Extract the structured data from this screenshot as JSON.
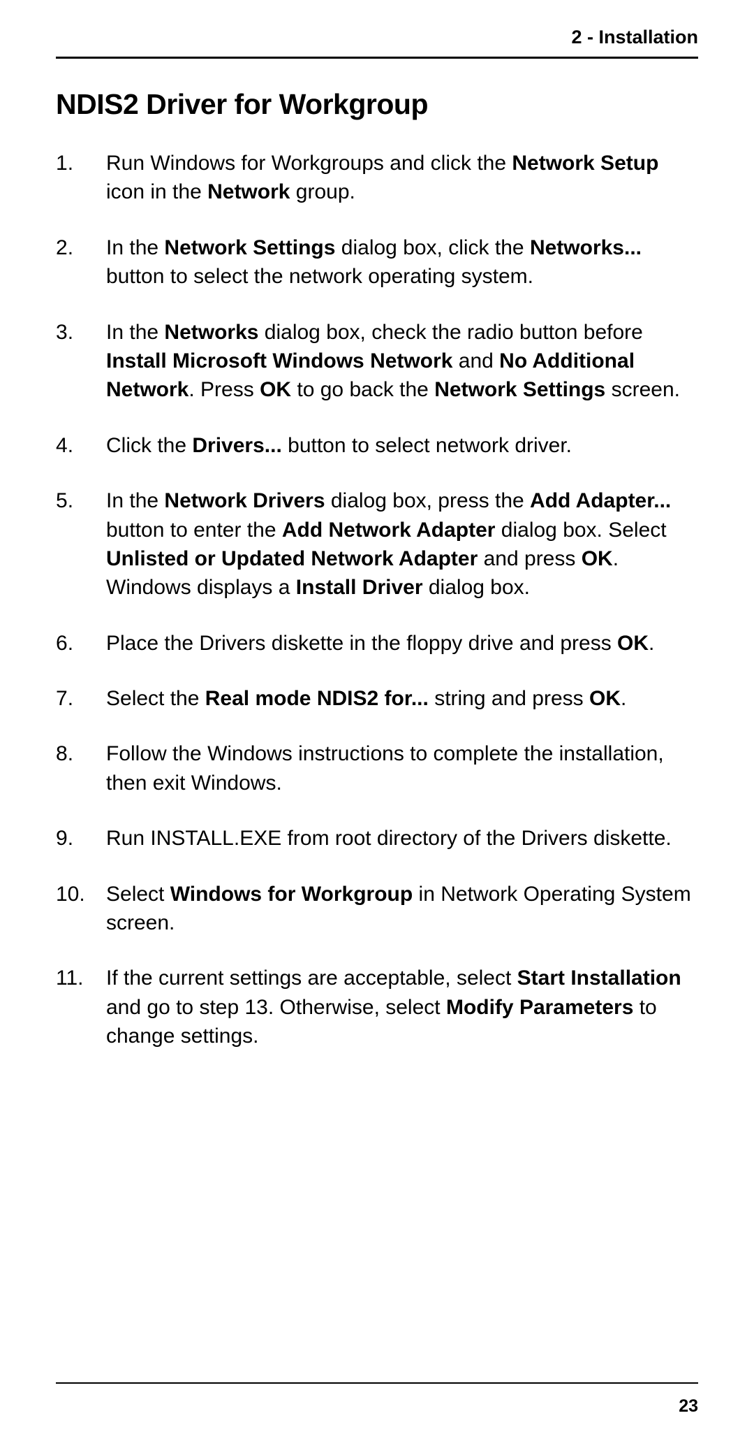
{
  "header": {
    "chapter": "2 - Installation"
  },
  "heading": "NDIS2 Driver for Workgroup",
  "steps": {
    "s1": {
      "t1": "Run Windows for Workgroups and click the ",
      "b1": "Network Setup",
      "t2": " icon in the ",
      "b2": "Network",
      "t3": " group."
    },
    "s2": {
      "t1": "In the ",
      "b1": "Network Settings",
      "t2": " dialog box, click the ",
      "b2": "Networks...",
      "t3": " button to select the network operating system."
    },
    "s3": {
      "t1": "In the ",
      "b1": "Networks",
      "t2": " dialog box, check the radio button before ",
      "b2": "Install Microsoft Windows Network",
      "t3": " and ",
      "b3": "No Additional Network",
      "t4": ". Press ",
      "b4": "OK",
      "t5": " to go back the ",
      "b5": "Network Settings",
      "t6": " screen."
    },
    "s4": {
      "t1": "Click the ",
      "b1": "Drivers...",
      "t2": " button to select network driver."
    },
    "s5": {
      "t1": "In the ",
      "b1": "Network Drivers",
      "t2": " dialog box, press the ",
      "b2": "Add Adapter...",
      "t3": " button to enter the ",
      "b3": "Add Network Adapter",
      "t4": " dialog box.  Select ",
      "b4": "Unlisted or Updated Network Adapter",
      "t5": " and press ",
      "b5": "OK",
      "t6": ". Windows displays a ",
      "b6": "Install Driver",
      "t7": " dialog box."
    },
    "s6": {
      "t1": "Place the Drivers diskette in the floppy drive and press ",
      "b1": "OK",
      "t2": "."
    },
    "s7": {
      "t1": "Select the ",
      "b1": "Real mode NDIS2 for...",
      "t2": " string and press ",
      "b2": "OK",
      "t3": "."
    },
    "s8": {
      "t1": "Follow the Windows instructions to complete the installation, then exit Windows."
    },
    "s9": {
      "t1": "Run INSTALL.EXE from root directory of the Drivers diskette."
    },
    "s10": {
      "t1": "Select ",
      "b1": "Windows for Workgroup",
      "t2": " in Network Operating System screen."
    },
    "s11": {
      "t1": "If the current settings are acceptable, select ",
      "b1": "Start Installation",
      "t2": " and go to step 13. Otherwise, select ",
      "b2": "Modify Parameters",
      "t3": " to change settings."
    }
  },
  "footer": {
    "page": "23"
  }
}
